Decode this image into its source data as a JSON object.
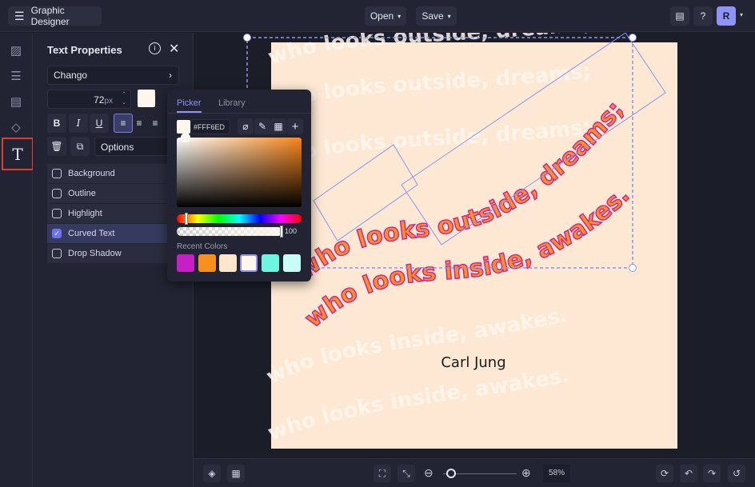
{
  "header": {
    "title": "Graphic Designer",
    "open_label": "Open",
    "save_label": "Save",
    "avatar": "R"
  },
  "panel": {
    "title": "Text Properties",
    "font": "Chango",
    "font_size": "72",
    "unit": "px",
    "options_label": "Options",
    "checkboxes": [
      {
        "label": "Background",
        "checked": false
      },
      {
        "label": "Outline",
        "checked": false
      },
      {
        "label": "Highlight",
        "checked": false
      },
      {
        "label": "Curved Text",
        "checked": true
      },
      {
        "label": "Drop Shadow",
        "checked": false
      }
    ]
  },
  "picker": {
    "tab_picker": "Picker",
    "tab_library": "Library",
    "hex": "#FFF6ED",
    "opacity": "100",
    "recent_label": "Recent Colors",
    "recent_colors": [
      "#c81ec8",
      "#f7901e",
      "#fde6cc",
      "#fff6ed",
      "#6ef5e0",
      "#c9fbf7"
    ]
  },
  "canvas": {
    "line1": "who looks outside, dreams;",
    "line2": "who looks inside, awakes.",
    "author": "Carl Jung",
    "page_color": "#fde9d3",
    "text_color": "#f7931e",
    "stroke_color": "#d0269a"
  },
  "bottom": {
    "zoom": "58%",
    "zoom_fraction": 0.08
  }
}
